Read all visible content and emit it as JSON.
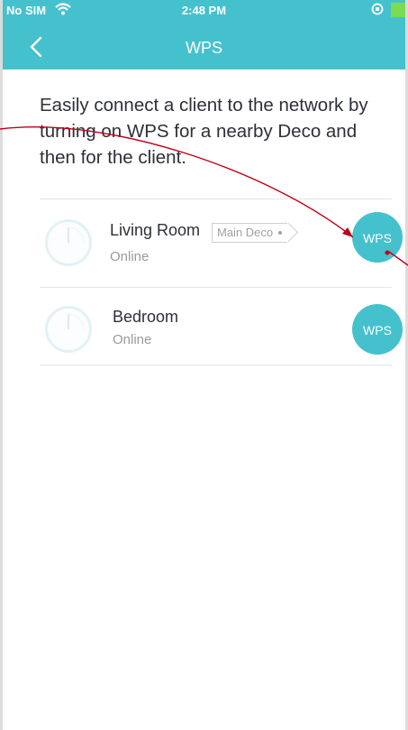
{
  "status_bar": {
    "carrier": "No SIM",
    "time": "2:48 PM"
  },
  "nav": {
    "back_icon": "chevron-left-icon",
    "title": "WPS"
  },
  "intro_text": "Easily connect a client to the network by turning on WPS for a nearby Deco and then for the client.",
  "devices": [
    {
      "name": "Living Room",
      "tag": "Main Deco",
      "status": "Online",
      "button_label": "WPS"
    },
    {
      "name": "Bedroom",
      "status": "Online",
      "button_label": "WPS"
    }
  ],
  "colors": {
    "accent": "#45c1cd",
    "annotation": "#c0001a"
  }
}
